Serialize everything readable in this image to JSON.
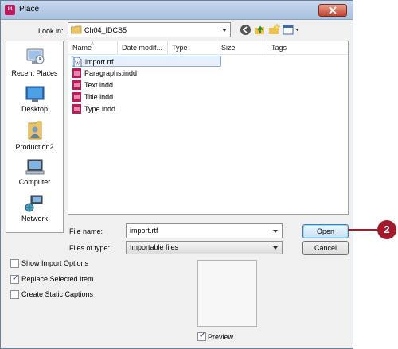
{
  "window": {
    "app_icon": "Id",
    "title": "Place",
    "close_icon": "close-icon"
  },
  "lookin": {
    "label": "Look in:",
    "value": "Ch04_IDCS5"
  },
  "toolbar": [
    "back-icon",
    "up-folder-icon",
    "new-folder-icon",
    "views-menu-icon"
  ],
  "places": [
    {
      "label": "Recent Places",
      "icon": "recent-places-icon"
    },
    {
      "label": "Desktop",
      "icon": "desktop-icon"
    },
    {
      "label": "Production2",
      "icon": "user-folder-icon"
    },
    {
      "label": "Computer",
      "icon": "computer-icon"
    },
    {
      "label": "Network",
      "icon": "network-icon"
    }
  ],
  "columns": [
    "Name",
    "Date modif...",
    "Type",
    "Size",
    "Tags"
  ],
  "files": [
    {
      "name": "import.rtf",
      "icon": "rtf-file-icon",
      "selected": true
    },
    {
      "name": "Paragraphs.indd",
      "icon": "indd-file-icon"
    },
    {
      "name": "Text.indd",
      "icon": "indd-file-icon"
    },
    {
      "name": "Title.indd",
      "icon": "indd-file-icon"
    },
    {
      "name": "Type.indd",
      "icon": "indd-file-icon"
    }
  ],
  "filename": {
    "label": "File name:",
    "value": "import.rtf"
  },
  "filetype": {
    "label": "Files of type:",
    "value": "Importable files"
  },
  "buttons": {
    "open": "Open",
    "cancel": "Cancel"
  },
  "options": [
    {
      "label": "Show Import Options",
      "checked": false
    },
    {
      "label": "Replace Selected Item",
      "checked": true
    },
    {
      "label": "Create Static Captions",
      "checked": false
    }
  ],
  "preview": {
    "label": "Preview",
    "checked": true
  },
  "callout": "2",
  "colors": {
    "callout": "#a31b2b",
    "indesign": "#c0185d",
    "selection": "#e8f1fb"
  }
}
